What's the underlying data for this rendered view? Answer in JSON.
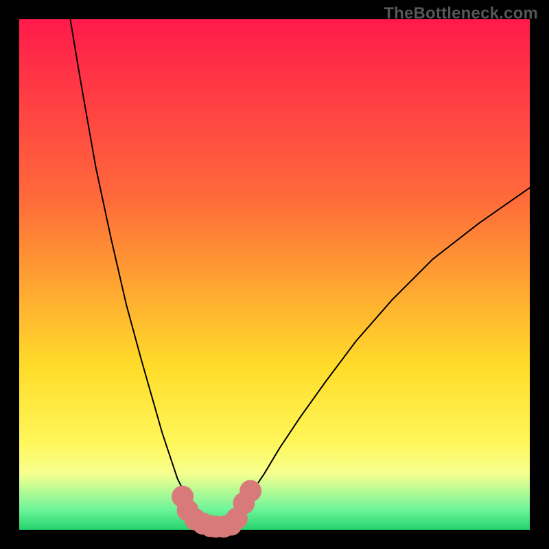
{
  "watermark": "TheBottleneck.com",
  "gradient_colors": {
    "top": "#ff1a4b",
    "mid1": "#ff6a3a",
    "mid2": "#ffdc2a",
    "mid3": "#fff75a",
    "mid4": "#f7ff8f",
    "mid5": "#6ef59a",
    "bottom": "#25d36e"
  },
  "chart_data": {
    "type": "line",
    "title": "",
    "xlabel": "",
    "ylabel": "",
    "xlim": [
      0,
      100
    ],
    "ylim": [
      0,
      100
    ],
    "grid": false,
    "legend": false,
    "series": [
      {
        "name": "curve-left",
        "color": "#000000",
        "stroke_width": 2,
        "x": [
          10,
          12,
          15,
          18,
          21,
          24,
          26,
          28,
          30,
          31,
          32,
          33,
          34,
          35,
          36,
          37,
          38
        ],
        "y": [
          100,
          88,
          71,
          57,
          44,
          33,
          26,
          19,
          13,
          10,
          8,
          5,
          4,
          3,
          2,
          1,
          1
        ]
      },
      {
        "name": "curve-right",
        "color": "#000000",
        "stroke_width": 2,
        "x": [
          41,
          42,
          44,
          46,
          48,
          51,
          55,
          60,
          66,
          73,
          81,
          90,
          100
        ],
        "y": [
          1,
          2,
          5,
          8,
          11,
          16,
          22,
          29,
          37,
          45,
          53,
          60,
          67
        ]
      },
      {
        "name": "marker-band",
        "color": "#d97a7a",
        "type": "scatter",
        "marker_size": 16,
        "x": [
          32.0,
          33.0,
          34.5,
          36.0,
          37.5,
          38.5,
          40.0,
          41.5,
          42.6,
          44.0,
          45.3
        ],
        "y": [
          6.5,
          3.8,
          2.0,
          1.2,
          0.7,
          0.6,
          0.6,
          1.0,
          2.2,
          5.2,
          7.6
        ]
      }
    ]
  }
}
